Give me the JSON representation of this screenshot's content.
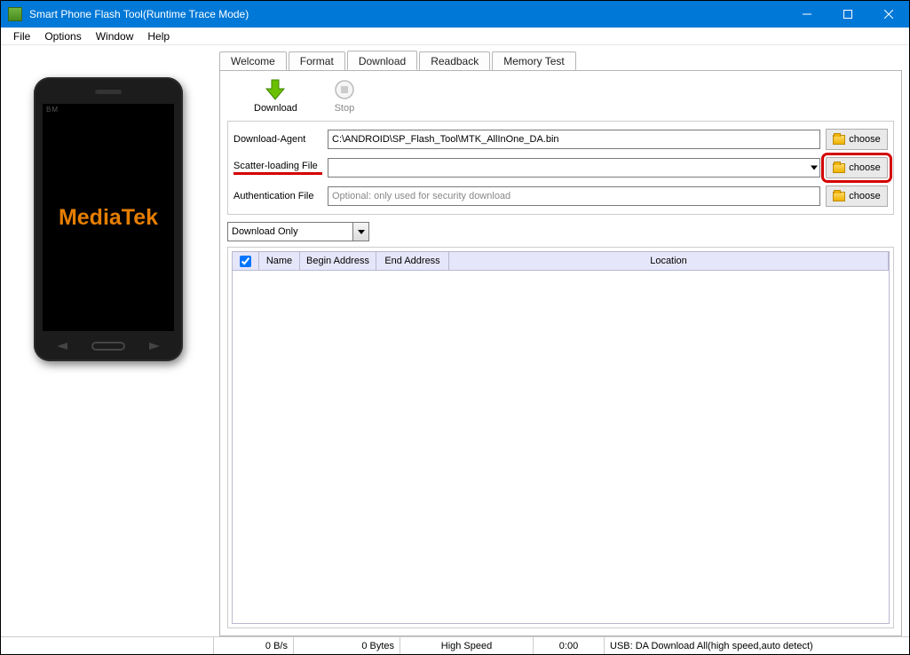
{
  "window": {
    "title": "Smart Phone Flash Tool(Runtime Trace Mode)"
  },
  "menu": {
    "file": "File",
    "options": "Options",
    "window": "Window",
    "help": "Help"
  },
  "tabs": {
    "welcome": "Welcome",
    "format": "Format",
    "download": "Download",
    "readback": "Readback",
    "memtest": "Memory Test"
  },
  "toolbar": {
    "download": "Download",
    "stop": "Stop"
  },
  "fields": {
    "da_label": "Download-Agent",
    "da_value": "C:\\ANDROID\\SP_Flash_Tool\\MTK_AllInOne_DA.bin",
    "scatter_label": "Scatter-loading File",
    "scatter_value": "",
    "auth_label": "Authentication File",
    "auth_placeholder": "Optional: only used for security download",
    "choose": "choose"
  },
  "mode": {
    "selected": "Download Only"
  },
  "table": {
    "headers": {
      "name": "Name",
      "begin": "Begin Address",
      "end": "End Address",
      "location": "Location"
    }
  },
  "phone": {
    "brand": "MediaTek",
    "bm": "BM"
  },
  "status": {
    "speed": "0 B/s",
    "bytes": "0 Bytes",
    "mode": "High Speed",
    "time": "0:00",
    "usb": "USB: DA Download All(high speed,auto detect)"
  }
}
